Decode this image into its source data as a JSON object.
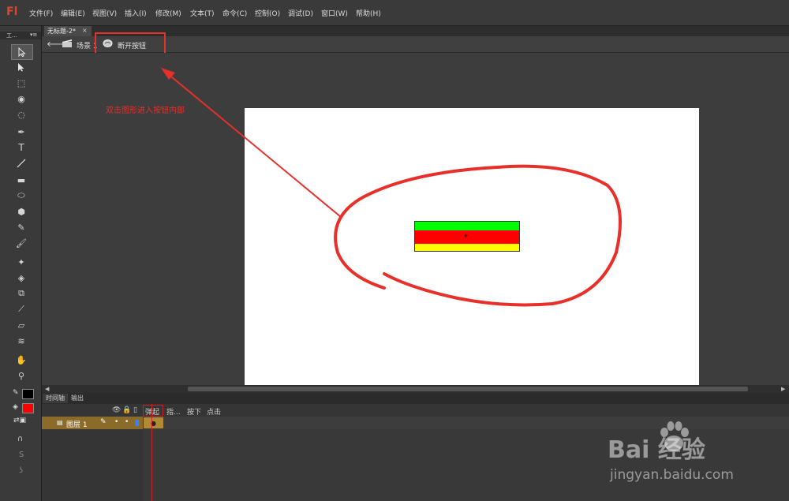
{
  "app": {
    "logo": "Fl"
  },
  "menu": [
    {
      "label": "文件(F)"
    },
    {
      "label": "编辑(E)"
    },
    {
      "label": "视图(V)"
    },
    {
      "label": "插入(I)"
    },
    {
      "label": "修改(M)"
    },
    {
      "label": "文本(T)"
    },
    {
      "label": "命令(C)"
    },
    {
      "label": "控制(O)"
    },
    {
      "label": "调试(D)"
    },
    {
      "label": "窗口(W)"
    },
    {
      "label": "帮助(H)"
    }
  ],
  "toolbar": {
    "header": "工..."
  },
  "document": {
    "tab_label": "无标题-2*",
    "tab_close": "×"
  },
  "editbar": {
    "scene_label": "场景 1",
    "symbol_label": "断开按钮"
  },
  "annotation": {
    "text": "双击图形进入按钮内部",
    "color": "#e8302b"
  },
  "button_symbol": {
    "top_color": "#00ff00",
    "middle_color": "#ff0000",
    "bottom_color": "#ffff00"
  },
  "timeline": {
    "tabs": [
      "时间轴",
      "输出"
    ],
    "frame_labels": [
      "弹起",
      "指...",
      "按下",
      "点击"
    ],
    "layer_name": "图层 1"
  },
  "watermark": {
    "logo": "Bai  经验",
    "url": "jingyan.baidu.com"
  }
}
